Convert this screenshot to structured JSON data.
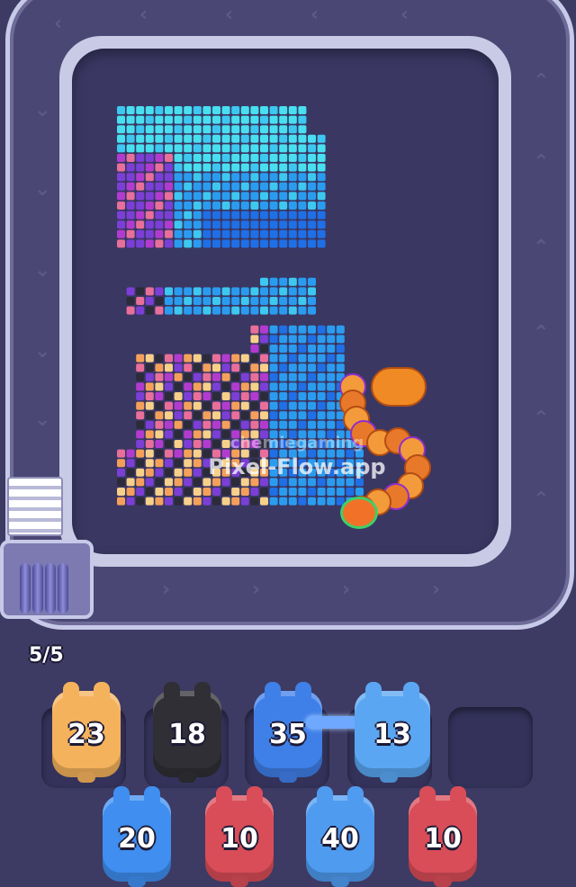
{
  "colors": {
    "background": "#3d3a63",
    "track": "#4a4774",
    "board": "#3a3763"
  },
  "hud": {
    "capacity": "5/5"
  },
  "board": {
    "watermark_line1": "chemiegaming",
    "watermark_line2": "Pixel-Flow.app"
  },
  "queue_slots": [
    {
      "count": "23",
      "color": "#f5b25c"
    },
    {
      "count": "18",
      "color": "#2f2f35"
    },
    {
      "count": "35",
      "color": "#3f7fe8"
    },
    {
      "count": "13",
      "color": "#5aa6f2"
    },
    {
      "count": "",
      "color": ""
    }
  ],
  "reserve": [
    {
      "count": "20",
      "color": "#3f8ef0"
    },
    {
      "count": "10",
      "color": "#d94d58"
    },
    {
      "count": "40",
      "color": "#4f9bf0"
    },
    {
      "count": "10",
      "color": "#d94d58"
    }
  ],
  "icons": {
    "track_arrows": "chevron-icon",
    "snake": "snake-icon",
    "target": "target-ring-icon"
  }
}
